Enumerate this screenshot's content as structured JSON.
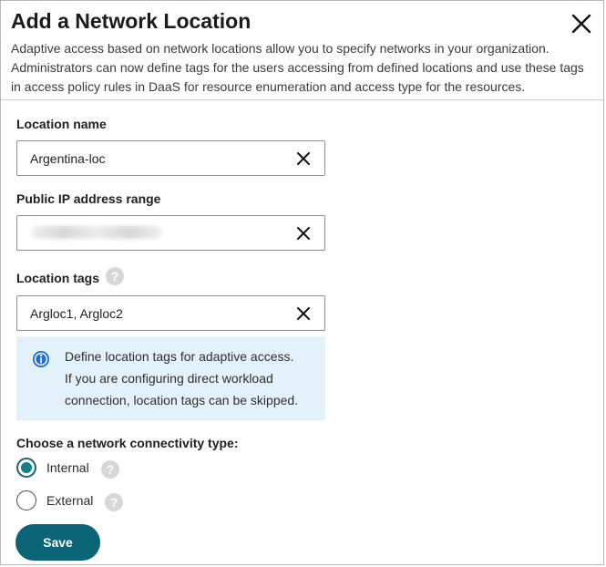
{
  "dialog": {
    "title": "Add a Network Location",
    "description": "Adaptive access based on network locations allow you to specify networks in your organization. Administrators can now define tags for the users accessing from defined locations and use these tags in access policy rules in DaaS for resource enumeration and access type for the resources.",
    "close_icon": "close-icon"
  },
  "fields": {
    "location_name": {
      "label": "Location name",
      "value": "Argentina-loc",
      "clear_icon": "close-icon"
    },
    "public_ip_range": {
      "label": "Public IP address range",
      "value_state": "blurred",
      "clear_icon": "close-icon"
    },
    "location_tags": {
      "label": "Location tags",
      "help_icon": "help-icon",
      "help_glyph": "?",
      "value": "Argloc1, Argloc2",
      "clear_icon": "close-icon"
    }
  },
  "info": {
    "icon": "info-icon",
    "lines": [
      "Define location tags for adaptive access.",
      "If you are configuring direct workload",
      "connection, location tags can be skipped."
    ],
    "background_color": "#e3f1fb",
    "icon_color": "#1f6fd1"
  },
  "connectivity": {
    "label": "Choose a network connectivity type:",
    "options": [
      {
        "label": "Internal",
        "selected": true,
        "help_icon": "help-icon",
        "help_glyph": "?"
      },
      {
        "label": "External",
        "selected": false,
        "help_icon": "help-icon",
        "help_glyph": "?"
      }
    ],
    "selected_color": "#167d8a"
  },
  "actions": {
    "save_label": "Save",
    "save_color": "#0b6476"
  }
}
